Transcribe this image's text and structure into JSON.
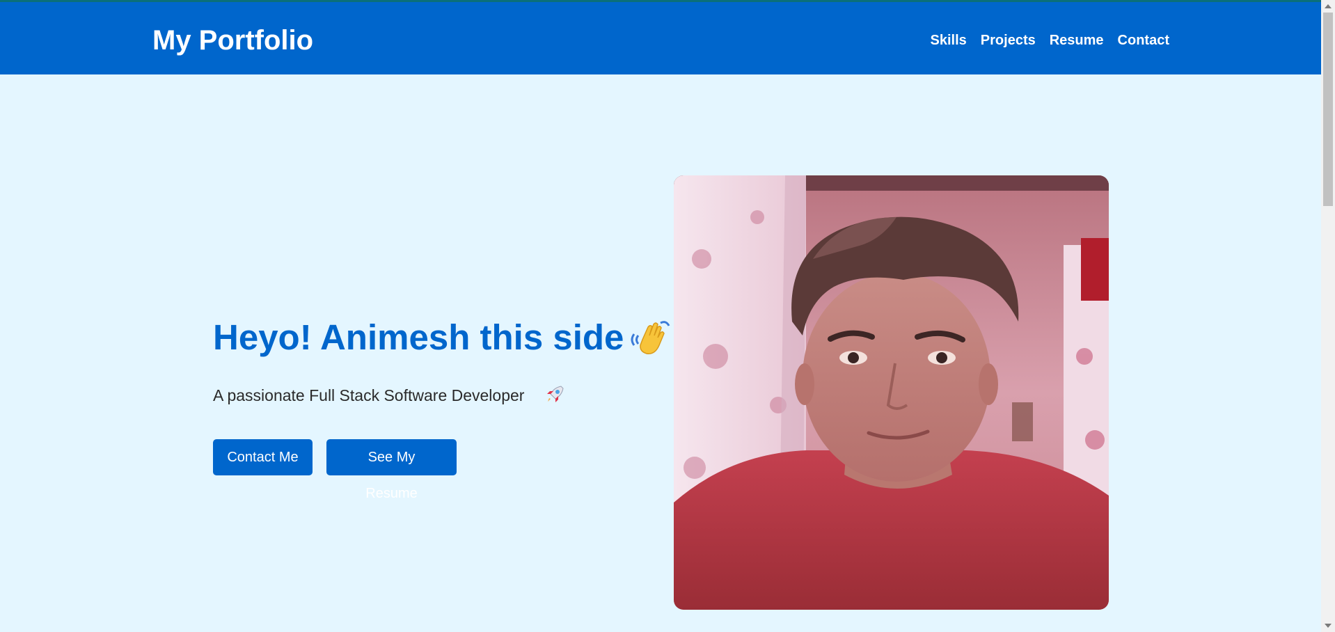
{
  "navbar": {
    "brand": "My Portfolio",
    "links": [
      "Skills",
      "Projects",
      "Resume",
      "Contact"
    ]
  },
  "hero": {
    "title": "Heyo! Animesh this side",
    "wave_icon": "waving-hand-emoji",
    "subtitle": "A passionate Full Stack Software Developer",
    "rocket_icon": "rocket-emoji",
    "buttons": {
      "contact": "Contact Me",
      "resume": "See My Resume"
    },
    "photo_alt": "Animesh profile photo"
  },
  "colors": {
    "primary": "#0066cc",
    "background": "#e4f6ff",
    "text": "#2a2a2a"
  }
}
